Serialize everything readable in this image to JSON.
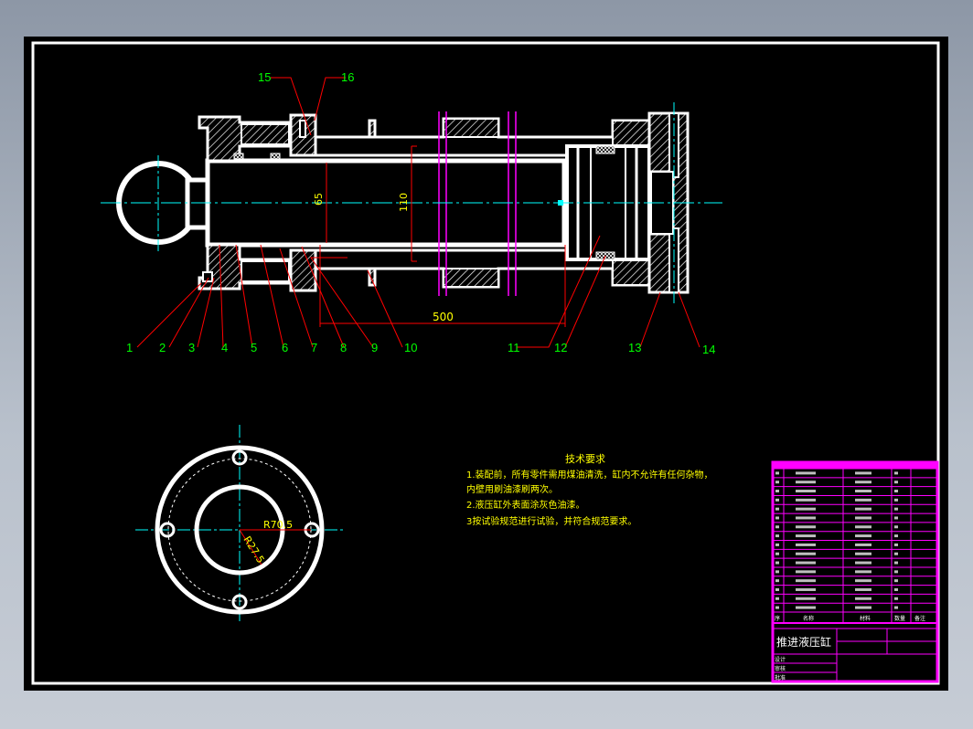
{
  "drawing": {
    "dimensions": {
      "length": "500",
      "bore": "110",
      "rod": "65",
      "bolt_circle": "R70.5",
      "inner_radius": "R27.5"
    },
    "part_callouts": [
      "1",
      "2",
      "3",
      "4",
      "5",
      "6",
      "7",
      "8",
      "9",
      "10",
      "11",
      "12",
      "13",
      "14",
      "15",
      "16"
    ],
    "tech_requirements": {
      "title": "技术要求",
      "lines": [
        "1.装配前，所有零件需用煤油清洗，缸内不允许有任何杂物，",
        "内壁用刷油漆刷两次。",
        "2.液压缸外表面涂灰色油漆。",
        "3按试验规范进行试验，并符合规范要求。"
      ]
    },
    "title_block": {
      "drawing_title": "推进液压缸",
      "header_row": [
        "序",
        "名称",
        "材料",
        "数量",
        "备注"
      ],
      "meta_labels": [
        "设计",
        "审核",
        "批准"
      ]
    }
  },
  "colors": {
    "frame_bg": "#000000",
    "outline": "#ffffff",
    "centerline": "#00ffff",
    "leader": "#ff0000",
    "callout": "#00ff00",
    "text": "#ffff00",
    "table": "#ff00ff"
  }
}
